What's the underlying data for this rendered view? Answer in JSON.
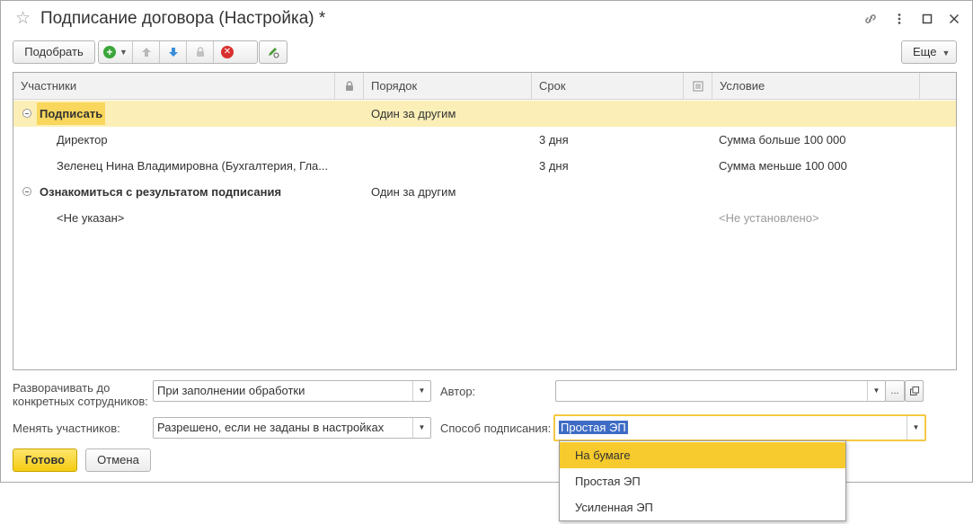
{
  "window": {
    "title": "Подписание договора (Настройка) *"
  },
  "toolbar": {
    "pick_label": "Подобрать",
    "more_label": "Еще"
  },
  "grid": {
    "columns": [
      "Участники",
      "Порядок",
      "Срок",
      "Условие"
    ],
    "rows": [
      {
        "name": "Подписать",
        "order": "Один за другим",
        "term": "",
        "condition": ""
      },
      {
        "name": "Директор",
        "order": "",
        "term": "3 дня",
        "condition": "Сумма больше 100 000"
      },
      {
        "name": "Зеленец Нина Владимировна (Бухгалтерия, Гла...",
        "order": "",
        "term": "3 дня",
        "condition": "Сумма меньше 100 000"
      },
      {
        "name": "Ознакомиться с результатом подписания",
        "order": "Один за другим",
        "term": "",
        "condition": ""
      },
      {
        "name": "<Не указан>",
        "order": "",
        "term": "",
        "condition": "<Не установлено>"
      }
    ]
  },
  "form": {
    "expand_label": "Разворачивать до\nконкретных сотрудников:",
    "expand_label_line1": "Разворачивать до",
    "expand_label_line2": "конкретных сотрудников:",
    "expand_value": "При заполнении обработки",
    "change_label": "Менять участников:",
    "change_value": "Разрешено, если не заданы в настройках",
    "author_label": "Автор:",
    "author_value": "",
    "author_select": "...",
    "signing_label": "Способ подписания:",
    "signing_value": "Простая ЭП"
  },
  "buttons": {
    "done": "Готово",
    "cancel": "Отмена"
  },
  "dropdown": {
    "options": [
      "На бумаге",
      "Простая ЭП",
      "Усиленная ЭП"
    ],
    "highlighted_index": 0
  },
  "colors": {
    "selected_row": "#fbefb7",
    "selected_name": "#f9d65c",
    "primary_button": "#f4cd11",
    "dropdown_hover": "#f7ca2d",
    "focus_border": "#f5c842",
    "text_highlight": "#3e6cc5"
  }
}
